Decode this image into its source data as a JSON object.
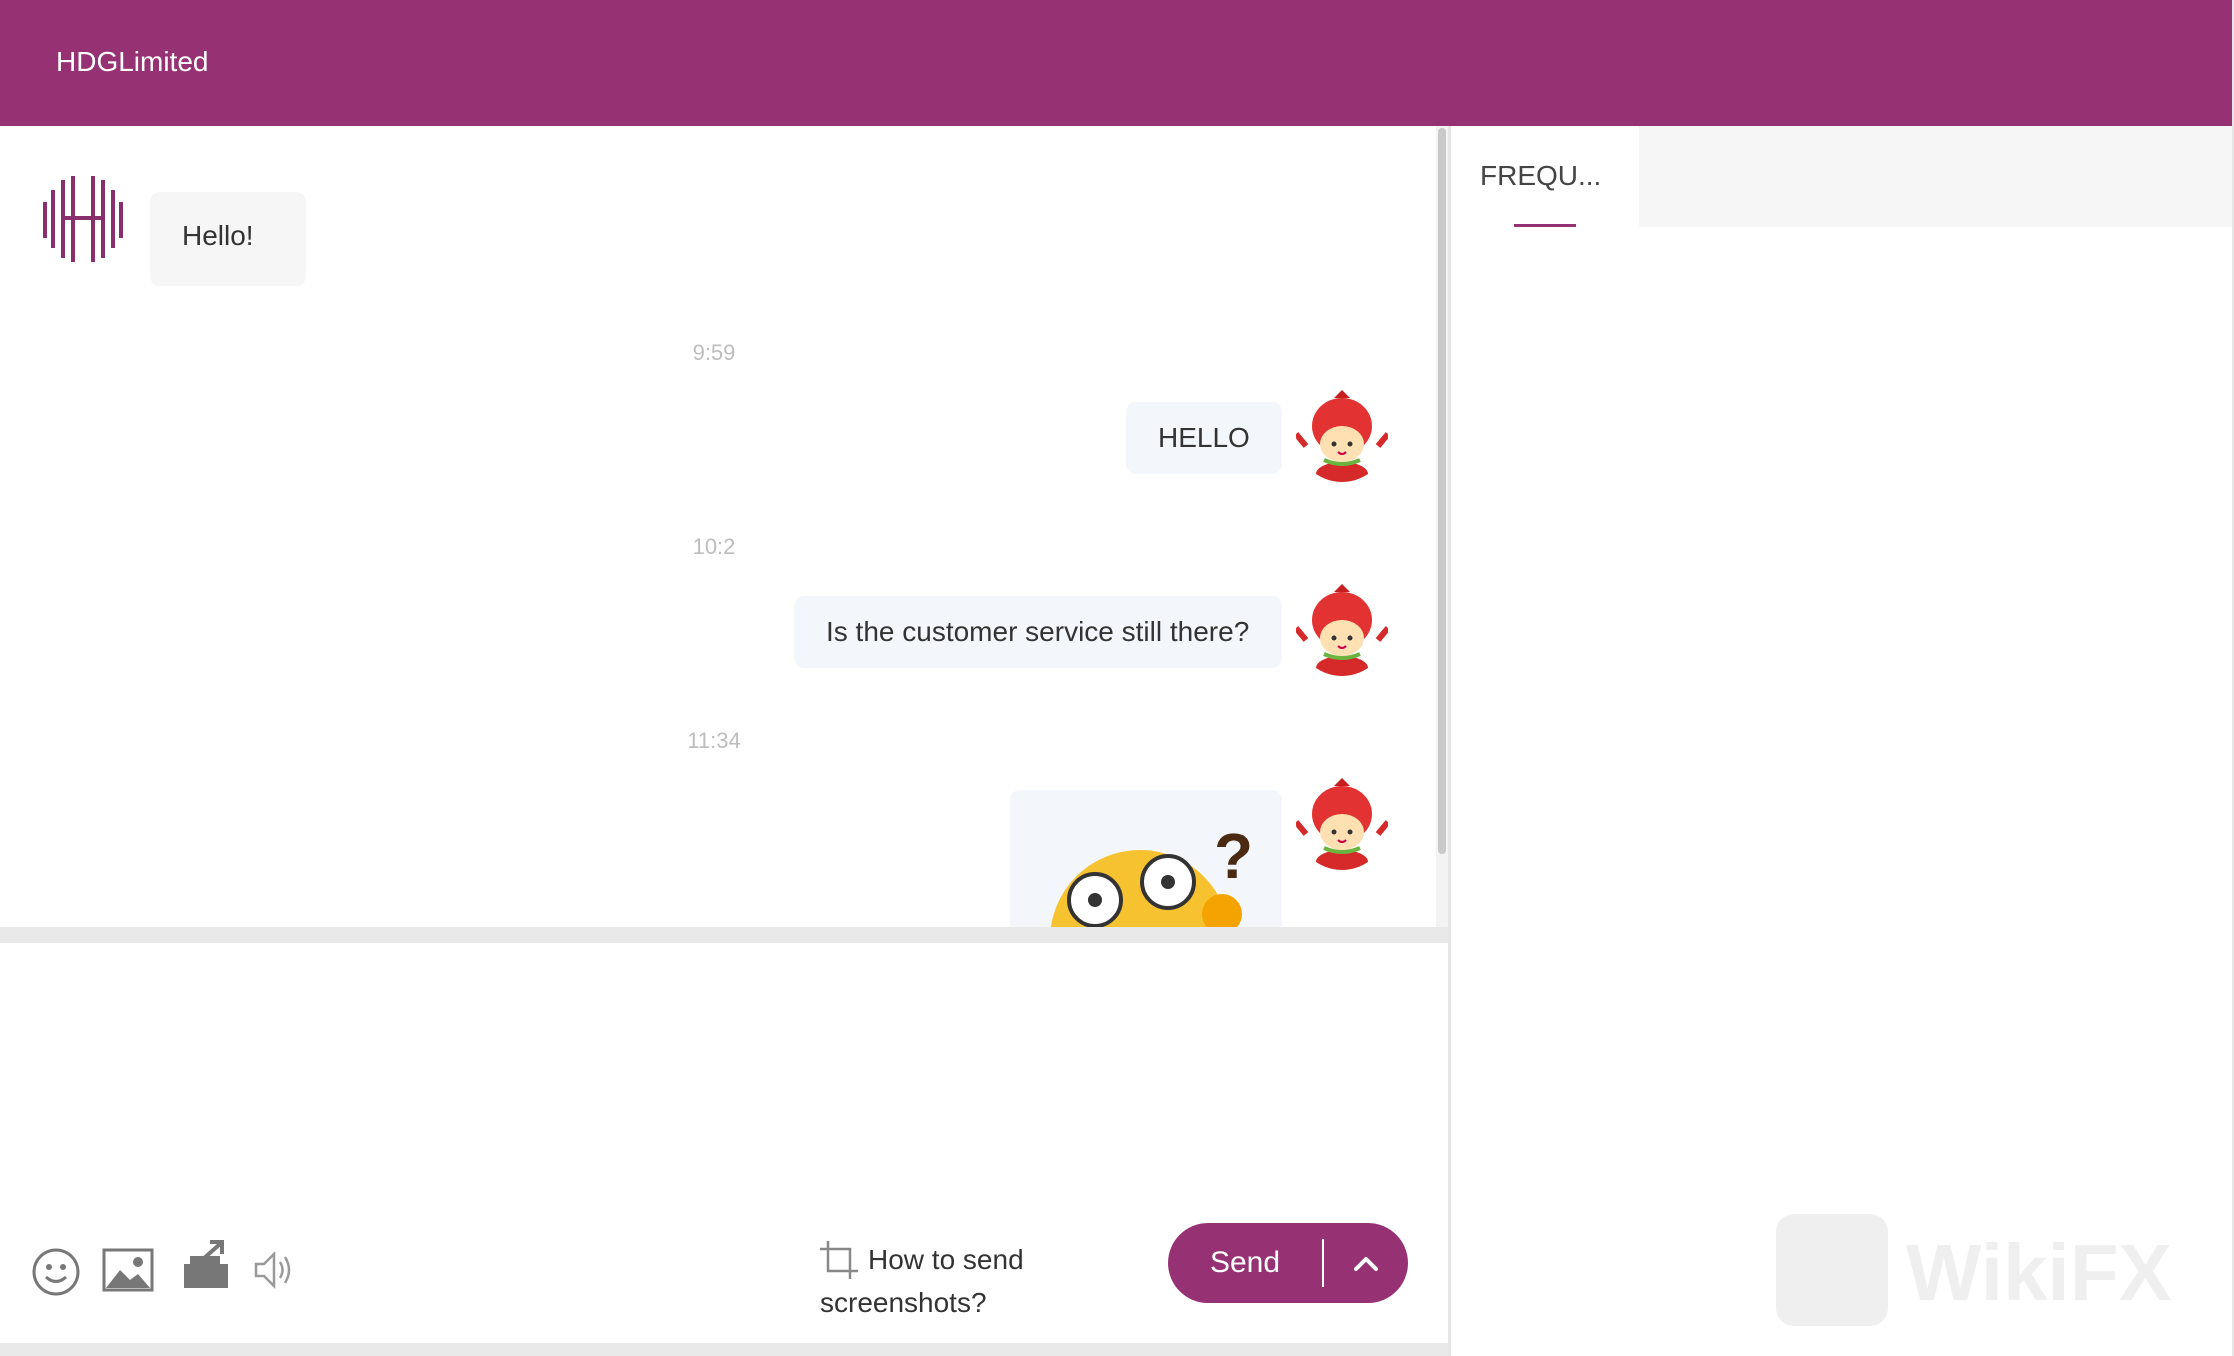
{
  "header": {
    "title": "HDGLimited"
  },
  "colors": {
    "brand": "#963274",
    "bubble_user": "#f3f7fb",
    "bubble_agent": "#f6f6f6",
    "timestamp": "#bdbdbd"
  },
  "messages": [
    {
      "sender": "agent",
      "text": "Hello!"
    },
    {
      "type": "time",
      "text": "9:59"
    },
    {
      "sender": "user",
      "text": "HELLO"
    },
    {
      "type": "time",
      "text": "10:2"
    },
    {
      "sender": "user",
      "text": "Is the customer service still there?"
    },
    {
      "type": "time",
      "text": "11:34"
    },
    {
      "sender": "user",
      "sticker": "confused-face-question-sticker"
    }
  ],
  "composer": {
    "icons": [
      "emoji-icon",
      "image-icon",
      "file-upload-icon",
      "volume-icon"
    ],
    "screenshot_hint": "How to send screenshots?",
    "send_label": "Send",
    "send_options_icon": "chevron-up-icon"
  },
  "side_panel": {
    "tabs": [
      {
        "label": "FREQU...",
        "active": true
      }
    ]
  },
  "watermark": {
    "text": "WikiFX"
  }
}
